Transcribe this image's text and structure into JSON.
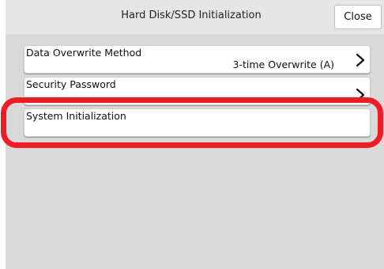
{
  "header": {
    "title": "Hard Disk/SSD Initialization",
    "close_label": "Close"
  },
  "rows": [
    {
      "label": "Data Overwrite Method",
      "value": "3-time Overwrite (A)"
    },
    {
      "label": "Security Password",
      "value": ""
    },
    {
      "label": "System Initialization",
      "value": ""
    }
  ],
  "colors": {
    "highlight": "#ee1c24",
    "panel_bg": "#d9d9d9"
  },
  "icons": {
    "row_chevron": "chevron-right-icon"
  }
}
